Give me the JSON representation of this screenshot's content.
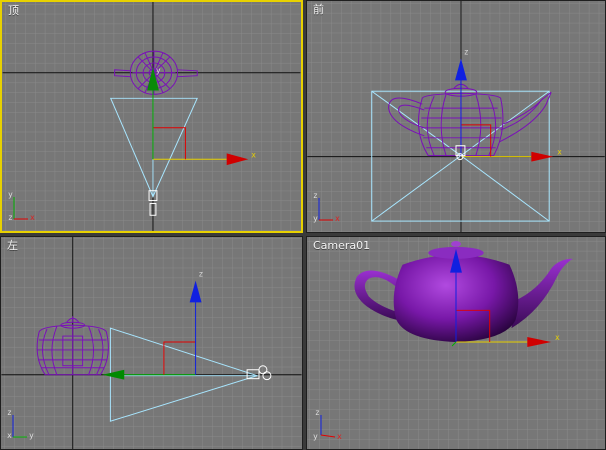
{
  "viewports": {
    "top": {
      "label": "顶",
      "active": true
    },
    "front": {
      "label": "前",
      "active": false
    },
    "left": {
      "label": "左",
      "active": false
    },
    "camera": {
      "label": "Camera01",
      "active": false
    }
  },
  "axes": {
    "x": "x",
    "y": "y",
    "z": "z"
  },
  "colors": {
    "viewport_bg": "#777777",
    "grid_minor": "#838383",
    "grid_major": "#101010",
    "teapot_wire": "#6a00a8",
    "camera_cone": "#a8e6ff",
    "axis_x": "#e00000",
    "axis_y": "#00b000",
    "axis_z": "#1020e0",
    "active_border": "#e8d100"
  },
  "icons": [
    "teapot-wireframe",
    "camera-cone",
    "transform-gizmo",
    "camera-icon",
    "axis-tripod"
  ]
}
